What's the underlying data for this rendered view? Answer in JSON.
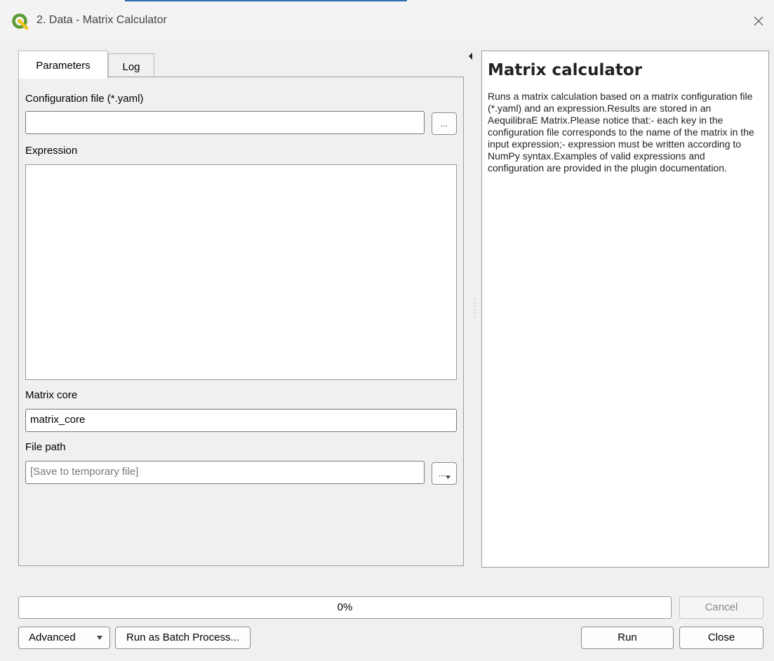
{
  "window": {
    "title": "2. Data - Matrix Calculator"
  },
  "tabs": [
    {
      "label": "Parameters",
      "active": true
    },
    {
      "label": "Log",
      "active": false
    }
  ],
  "params": {
    "config_label": "Configuration file (*.yaml)",
    "config_value": "",
    "browse_label": "...",
    "expression_label": "Expression",
    "expression_value": "",
    "core_label": "Matrix core",
    "core_value": "matrix_core",
    "filepath_label": "File path",
    "filepath_placeholder": "[Save to temporary file]",
    "filepath_browse_label": "..."
  },
  "help": {
    "title": "Matrix calculator",
    "body": "Runs a matrix calculation based on a matrix configuration file (*.yaml) and an expression.Results are stored in an AequilibraE Matrix.Please notice that:- each key in the configuration file corresponds to the name of the matrix in the input expression;- expression must be written according to NumPy syntax.Examples of valid expressions and configuration are provided in the plugin documentation."
  },
  "progress": {
    "text": "0%",
    "value": 0
  },
  "buttons": {
    "cancel": "Cancel",
    "advanced": "Advanced",
    "batch": "Run as Batch Process...",
    "run": "Run",
    "close": "Close"
  },
  "icons": {
    "app": "qgis-logo-icon",
    "close": "close-icon",
    "collapse": "collapse-arrow-icon",
    "dropdown": "chevron-down-icon"
  },
  "colors": {
    "qgis_green": "#5b9b35",
    "qgis_yellow": "#f0c419"
  }
}
